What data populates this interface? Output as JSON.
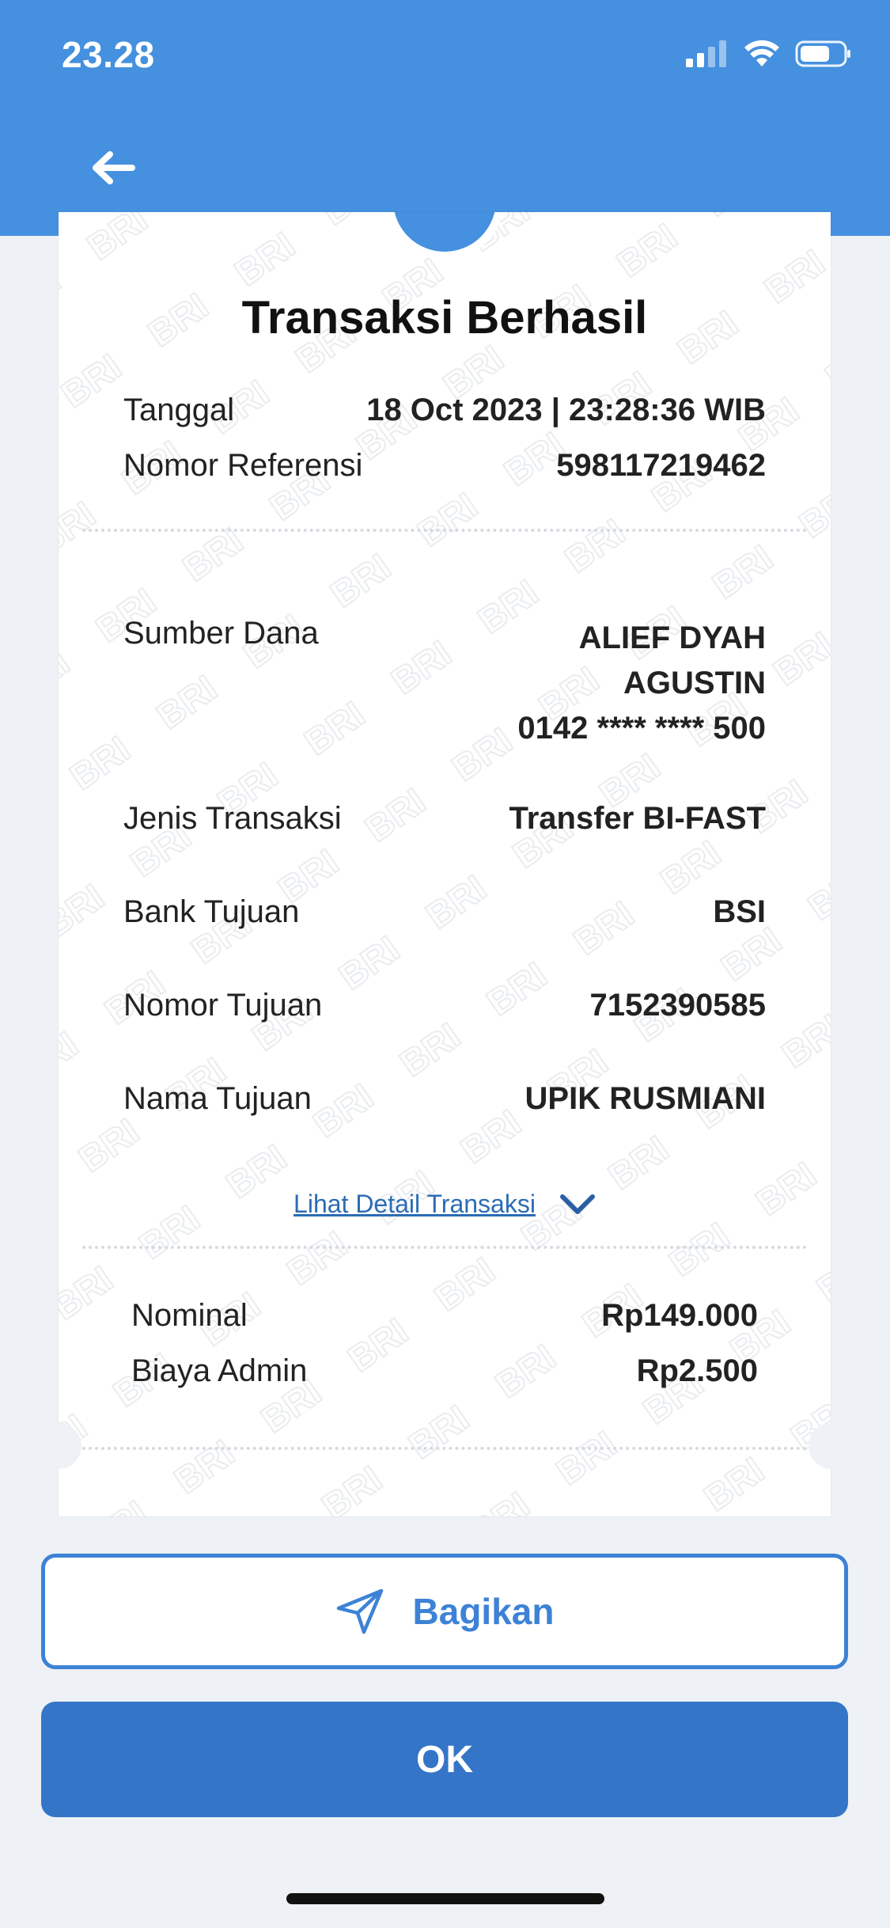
{
  "status_bar": {
    "time": "23.28"
  },
  "header": {
    "back_icon": "arrow-left-icon"
  },
  "receipt": {
    "title": "Transaksi Berhasil",
    "summary": [
      {
        "label": "Tanggal",
        "value": "18 Oct 2023 | 23:28:36 WIB"
      },
      {
        "label": "Nomor Referensi",
        "value": "598117219462"
      }
    ],
    "source": {
      "label": "Sumber Dana",
      "name_line1": "ALIEF DYAH",
      "name_line2": "AGUSTIN",
      "account": "0142 **** **** 500"
    },
    "details": [
      {
        "label": "Jenis Transaksi",
        "value": "Transfer BI-FAST"
      },
      {
        "label": "Bank Tujuan",
        "value": "BSI"
      },
      {
        "label": "Nomor Tujuan",
        "value": "7152390585"
      },
      {
        "label": "Nama Tujuan",
        "value": "UPIK RUSMIANI"
      }
    ],
    "detail_link": "Lihat Detail Transaksi",
    "amounts": [
      {
        "label": "Nominal",
        "value": "Rp149.000"
      },
      {
        "label": "Biaya Admin",
        "value": "Rp2.500"
      }
    ],
    "watermark_text": "BRI"
  },
  "actions": {
    "share_label": "Bagikan",
    "ok_label": "OK"
  },
  "colors": {
    "primary": "#4590df",
    "button": "#3575c8",
    "link": "#2b6cb5"
  }
}
